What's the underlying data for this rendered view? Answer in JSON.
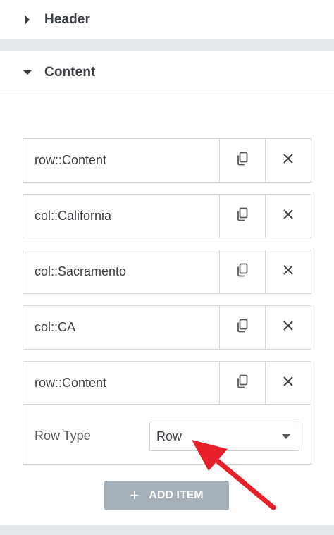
{
  "sections": {
    "header": {
      "title": "Header",
      "expanded": false
    },
    "content": {
      "title": "Content",
      "expanded": true
    }
  },
  "items": [
    {
      "label": "row::Content"
    },
    {
      "label": "col::California"
    },
    {
      "label": "col::Sacramento"
    },
    {
      "label": "col::CA"
    },
    {
      "label": "row::Content",
      "expanded": true
    }
  ],
  "expanded_item": {
    "field_label": "Row Type",
    "select_value": "Row"
  },
  "add_item": {
    "label": "ADD ITEM",
    "icon": "plus-icon"
  },
  "icons": {
    "duplicate": "copy-icon",
    "delete": "close-icon"
  },
  "colors": {
    "annotation_arrow": "#e8202a",
    "add_button_bg": "#a4afb7",
    "band": "#e6e9ec",
    "border": "#d5d8dc"
  }
}
